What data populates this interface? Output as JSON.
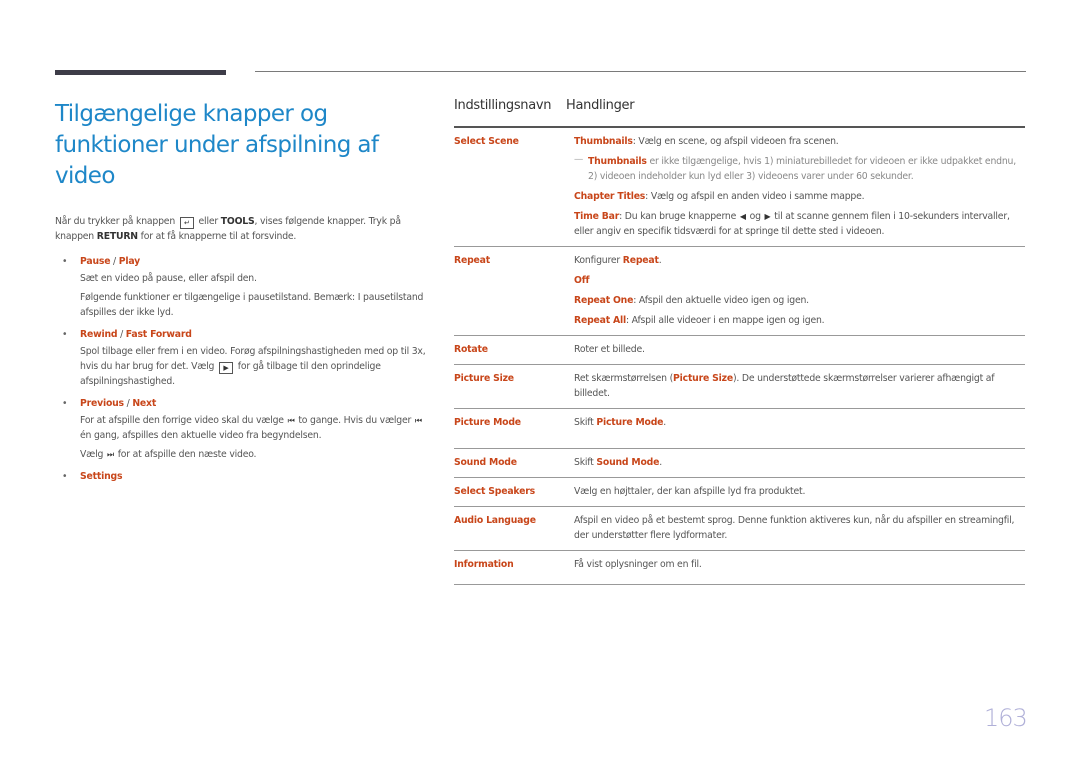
{
  "page": {
    "title": "Tilgængelige knapper og funktioner under afspilning af video",
    "page_number": "163"
  },
  "intro": {
    "t1": "Når du trykker på knappen ",
    "t2": " eller ",
    "tools": "TOOLS",
    "t3": ", vises følgende knapper. Tryk på knappen ",
    "return": "RETURN",
    "t4": " for at få knapperne til at forsvinde.",
    "tools_icon": "tools-icon"
  },
  "bullets": [
    {
      "a": "Pause",
      "b": "Play",
      "lines": [
        "Sæt en video på pause, eller afspil den.",
        "Følgende funktioner er tilgængelige i pausetilstand. Bemærk: I pausetilstand afspilles der ikke lyd."
      ]
    },
    {
      "a": "Rewind",
      "b": "Fast Forward",
      "l1": "Spol tilbage eller frem i en video. Forøg afspilningshastigheden med op til 3x, hvis du har brug for det. Vælg ",
      "l2": " for gå tilbage til den oprindelige afspilningshastighed.",
      "icon": "play-icon"
    },
    {
      "a": "Previous",
      "b": "Next",
      "l1": "For at afspille den forrige video skal du vælge ",
      "l2": " to gange. Hvis du vælger ",
      "l3": " én gang, afspilles den aktuelle video fra begyndelsen.",
      "l4": "Vælg ",
      "l5": " for at afspille den næste video.",
      "prev_icon": "previous-icon",
      "next_icon": "next-icon"
    },
    {
      "a": "Settings"
    }
  ],
  "table": {
    "headers": [
      "Indstillingsnavn",
      "Handlinger"
    ],
    "select_scene": {
      "name": "Select Scene",
      "thumb_label": "Thumbnails",
      "thumb_text": ": Vælg en scene, og afspil videoen fra scenen.",
      "note_label": "Thumbnails",
      "note_text": " er ikke tilgængelige, hvis 1) miniaturebilledet for videoen er ikke udpakket endnu, 2) videoen indeholder kun lyd eller 3) videoens varer under 60 sekunder.",
      "chapter_label": "Chapter Titles",
      "chapter_text": ": Vælg og afspil en anden video i samme mappe.",
      "timebar_label": "Time Bar",
      "timebar_t1": ": Du kan bruge knapperne ",
      "timebar_t2": " og ",
      "timebar_t3": " til at scanne gennem filen i 10-sekunders intervaller, eller angiv en specifik tidsværdi for at springe til dette sted i videoen."
    },
    "repeat": {
      "name": "Repeat",
      "t1": "Konfigurer ",
      "t1b": "Repeat",
      "t1c": ".",
      "off": "Off",
      "one_label": "Repeat One",
      "one_text": ": Afspil den aktuelle video igen og igen.",
      "all_label": "Repeat All",
      "all_text": ": Afspil alle videoer i en mappe igen og igen."
    },
    "rows": [
      {
        "name": "Rotate",
        "text": "Roter et billede."
      },
      {
        "name": "Picture Size",
        "t1": "Ret skærmstørrelsen (",
        "b": "Picture Size",
        "t2": "). De understøttede skærmstørrelser varierer afhængigt af billedet."
      },
      {
        "name": "Picture Mode",
        "t1": "Skift ",
        "b": "Picture Mode",
        "t2": "."
      },
      {
        "name": "Sound Mode",
        "t1": "Skift ",
        "b": "Sound Mode",
        "t2": "."
      },
      {
        "name": "Select Speakers",
        "text": "Vælg en højttaler, der kan afspille lyd fra produktet."
      },
      {
        "name": "Audio Language",
        "text": "Afspil en video på et bestemt sprog. Denne funktion aktiveres kun, når du afspiller en streamingfil, der understøtter flere lydformater."
      },
      {
        "name": "Information",
        "text": "Få vist oplysninger om en fil."
      }
    ]
  }
}
